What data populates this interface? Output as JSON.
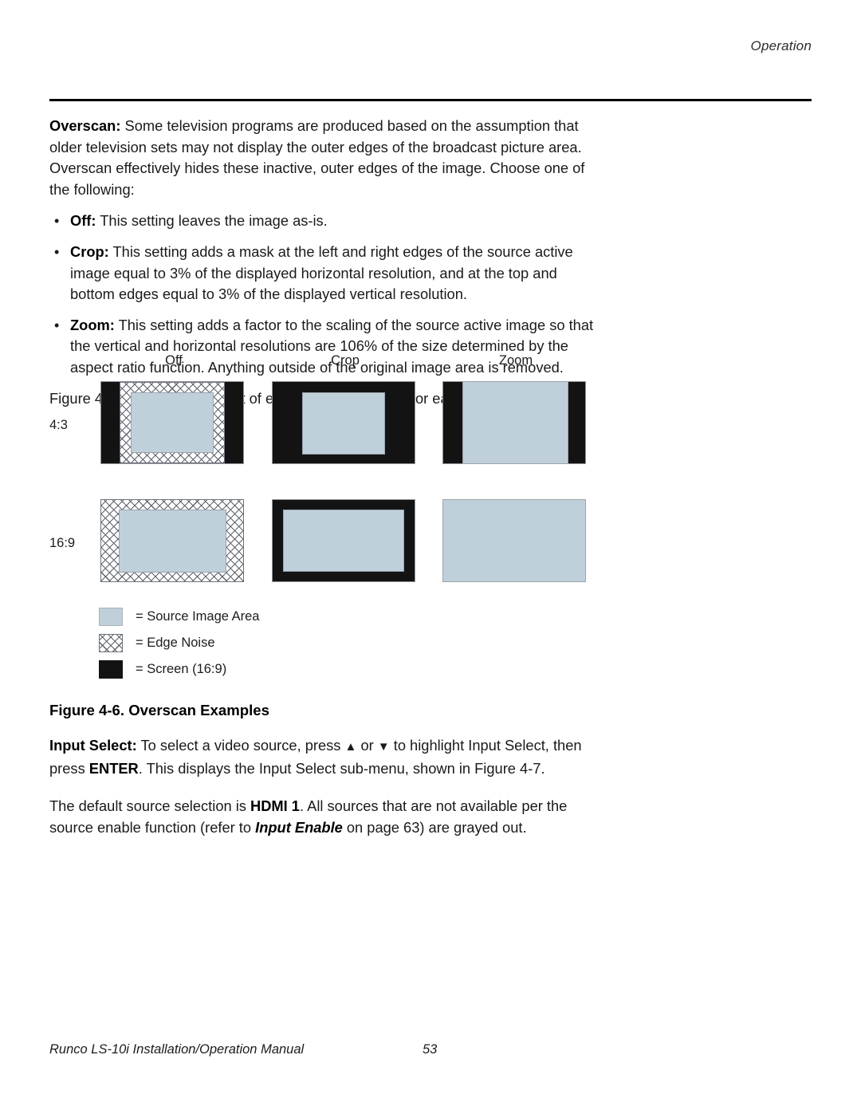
{
  "header": {
    "section_title": "Operation"
  },
  "body": {
    "overscan_label": "Overscan:",
    "overscan_text": " Some television programs are produced based on the assumption that older television sets may not display the outer edges of the broadcast picture area. Overscan effectively hides these inactive, outer edges of the image. Choose one of the following:",
    "bullets": [
      {
        "term": "Off:",
        "text": " This setting leaves the image as-is."
      },
      {
        "term": "Crop:",
        "text": " This setting adds a mask at the left and right edges of the source active image equal to 3% of the displayed horizontal resolution, and at the top and bottom edges equal to 3% of the displayed vertical resolution."
      },
      {
        "term": "Zoom:",
        "text": " This setting adds a factor to the scaling of the source active image so that the vertical and horizontal resolutions are 106% of the size determined by the aspect ratio function. Anything outside of the original image area is removed."
      }
    ],
    "figure_intro": "Figure 4-6 illustrates the effect of each overscan setting for each aspect ratio."
  },
  "figure": {
    "column_labels": [
      "Off",
      "Crop",
      "Zoom"
    ],
    "row_labels": [
      "4:3",
      "16:9"
    ],
    "legend": [
      {
        "swatch": "source-image-swatch",
        "text": "= Source Image Area"
      },
      {
        "swatch": "edge-noise-swatch",
        "text": "= Edge Noise"
      },
      {
        "swatch": "screen-swatch",
        "text": "= Screen (16:9)"
      }
    ],
    "caption": "Figure 4-6. Overscan Examples",
    "colors": {
      "source_image_area": "#bfd0da",
      "screen": "#131313",
      "edge_noise_line": "#5d626b"
    }
  },
  "tail": {
    "input_select_label": "Input Select:",
    "input_select_text_1": " To select a video source, press ",
    "arrow_up": "▲",
    "input_select_text_2": " or ",
    "arrow_down": "▼",
    "input_select_text_3": " to highlight Input Select, then press ",
    "enter_label": "ENTER",
    "input_select_text_4": ". This displays the Input Select sub-menu, shown in Figure 4-7.",
    "default_text_1": "The default source selection is ",
    "hdmi_label": "HDMI 1",
    "default_text_2": ". All sources that are not available per the source enable function (refer to ",
    "input_enable_label": "Input Enable",
    "default_text_3": " on page 63) are grayed out."
  },
  "footer": {
    "manual_title": "Runco LS-10i Installation/Operation Manual",
    "page_number": "53"
  }
}
